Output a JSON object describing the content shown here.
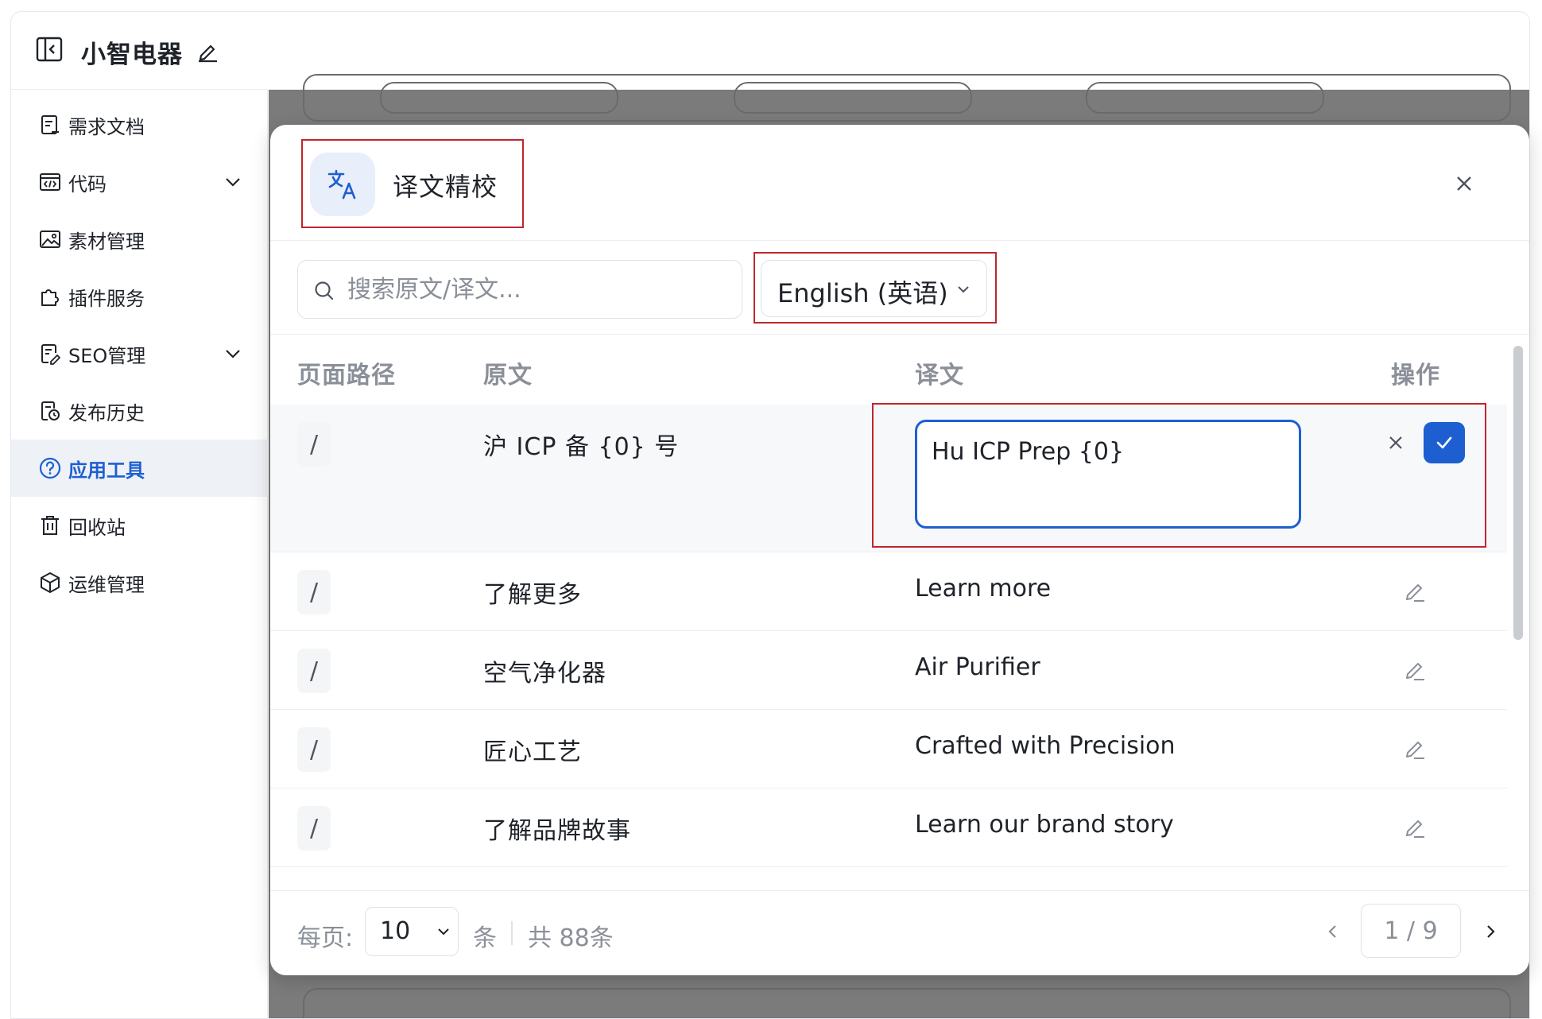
{
  "app": {
    "title": "小智电器"
  },
  "sidebar": {
    "items": [
      {
        "label": "需求文档",
        "icon": "document-icon"
      },
      {
        "label": "代码",
        "icon": "code-icon",
        "expandable": true
      },
      {
        "label": "素材管理",
        "icon": "image-icon"
      },
      {
        "label": "插件服务",
        "icon": "plugin-icon"
      },
      {
        "label": "SEO管理",
        "icon": "seo-icon",
        "expandable": true
      },
      {
        "label": "发布历史",
        "icon": "history-icon"
      },
      {
        "label": "应用工具",
        "icon": "help-circle-icon",
        "active": true
      },
      {
        "label": "回收站",
        "icon": "trash-icon"
      },
      {
        "label": "运维管理",
        "icon": "box-icon"
      }
    ]
  },
  "modal": {
    "title": "译文精校",
    "search_placeholder": "搜索原文/译文...",
    "language": "English (英语)",
    "columns": {
      "path": "页面路径",
      "source": "原文",
      "translation": "译文",
      "action": "操作"
    },
    "editing_row": {
      "path": "/",
      "source": "沪 ICP 备 {0} 号",
      "translation": "Hu ICP Prep {0}"
    },
    "rows": [
      {
        "path": "/",
        "source": "了解更多",
        "translation": "Learn more"
      },
      {
        "path": "/",
        "source": "空气净化器",
        "translation": "Air Purifier"
      },
      {
        "path": "/",
        "source": "匠心工艺",
        "translation": "Crafted with Precision"
      },
      {
        "path": "/",
        "source": "了解品牌故事",
        "translation": "Learn our brand story"
      }
    ],
    "pagination": {
      "per_page_label": "每页:",
      "per_page_value": "10",
      "unit_label": "条",
      "total_label": "共 88条",
      "page_indicator": "1 / 9"
    }
  },
  "colors": {
    "accent": "#1d5fd1",
    "highlight": "#c0262c",
    "active_bg": "#eef1f6"
  }
}
